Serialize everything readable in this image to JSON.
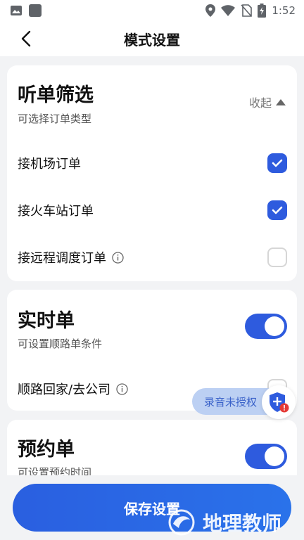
{
  "status": {
    "time": "1:52"
  },
  "nav": {
    "title": "模式设置"
  },
  "listen_filter": {
    "title": "听单筛选",
    "subtitle": "可选择订单类型",
    "collapse_label": "收起",
    "options": [
      {
        "label": "接机场订单",
        "checked": true
      },
      {
        "label": "接火车站订单",
        "checked": true
      },
      {
        "label": "接远程调度订单",
        "checked": false
      }
    ]
  },
  "realtime": {
    "title": "实时单",
    "subtitle": "可设置顺路单条件",
    "enabled": true,
    "option_label": "顺路回家/去公司"
  },
  "reservation": {
    "title": "预约单",
    "subtitle": "可设置预约时间",
    "enabled": true
  },
  "floating": {
    "record_label": "录音未授权"
  },
  "footer": {
    "save_label": "保存设置"
  },
  "watermark": {
    "text": "地理教师"
  },
  "colors": {
    "accent": "#2e5bde",
    "background": "#f2f3f5"
  }
}
